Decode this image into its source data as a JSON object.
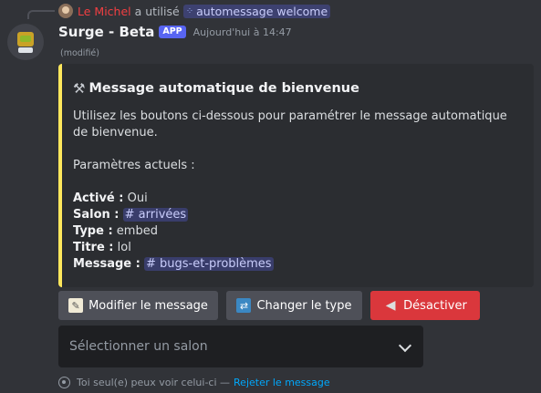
{
  "reply": {
    "user": "Le Michel",
    "text": "a utilisé",
    "command": "automessage welcome"
  },
  "message": {
    "author": "Surge - Beta",
    "badge": "APP",
    "timestamp": "Aujourd'hui à 14:47",
    "edited": "(modifié)"
  },
  "embed": {
    "accent_color": "#fee75c",
    "title_icon": "tools-icon",
    "title": "Message automatique de bienvenue",
    "description": "Utilisez les boutons ci-dessous pour paramétrer le message automatique de bienvenue.",
    "settings_header": "Paramètres actuels :",
    "fields": {
      "active_label": "Activé :",
      "active_value": "Oui",
      "channel_label": "Salon :",
      "channel_value": "# arrivées",
      "type_label": "Type :",
      "type_value": "embed",
      "title_label": "Titre :",
      "title_value": "lol",
      "message_label": "Message :",
      "message_value": "# bugs-et-problèmes"
    }
  },
  "buttons": {
    "edit_message": "Modifier le message",
    "change_type": "Changer le type",
    "disable": "Désactiver"
  },
  "select": {
    "placeholder": "Sélectionner un salon"
  },
  "footer": {
    "notice": "Toi seul(e) peux voir celui-ci —",
    "dismiss": "Rejeter le message"
  },
  "colors": {
    "background": "#313338",
    "embed_bg": "#2b2d31",
    "accent": "#fee75c",
    "danger": "#da373c",
    "link": "#00a8fc",
    "mention_bg": "#3c4270"
  }
}
